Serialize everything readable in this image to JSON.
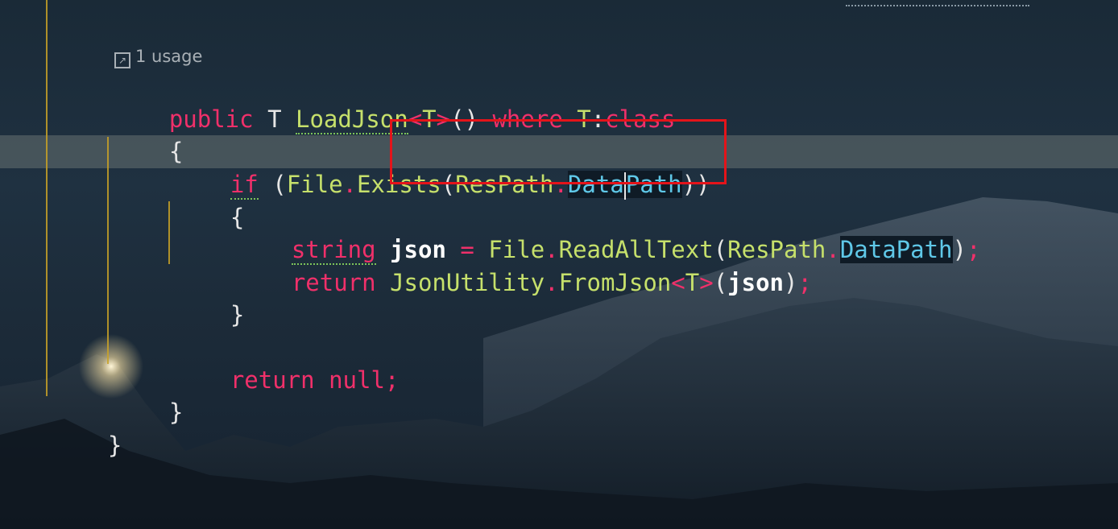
{
  "editor": {
    "usage_hint": "1 usage",
    "usage_icon": "external-link-icon",
    "lines": {
      "l1": {
        "kw_public": "public",
        "type_t": " T ",
        "method": "LoadJson",
        "generic_open": "<",
        "generic_t": "T",
        "generic_close": ">",
        "parens": "()",
        "kw_where": " where ",
        "constraint_t": "T",
        "colon": ":",
        "kw_class": "class"
      },
      "l2": {
        "brace": "{"
      },
      "l3": {
        "kw_if": "if",
        "open_paren": " (",
        "cls_file": "File",
        "dot1": ".",
        "fn_exists": "Exists",
        "paren2": "(",
        "cls_respath": "ResPath",
        "dot2": ".",
        "prop_data": "Data",
        "prop_path": "Path",
        "close": "))"
      },
      "l4": {
        "brace": "{"
      },
      "l5": {
        "kw_string": "string",
        "var_json": " json",
        "eq": " = ",
        "cls_file": "File",
        "dot1": ".",
        "fn_read": "ReadAllText",
        "paren": "(",
        "cls_respath": "ResPath",
        "dot2": ".",
        "prop": "DataPath",
        "close": ")",
        "semi": ";"
      },
      "l6": {
        "kw_return": "return",
        "cls_json": " JsonUtility",
        "dot": ".",
        "fn_from": "FromJson",
        "lt": "<",
        "t": "T",
        "gt": ">",
        "paren": "(",
        "var": "json",
        "close": ")",
        "semi": ";"
      },
      "l7": {
        "brace": "}"
      },
      "l8": {
        "kw_return": "return",
        "kw_null": " null",
        "semi": ";"
      },
      "l9": {
        "brace": "}"
      },
      "l10": {
        "brace": "}"
      }
    },
    "colors": {
      "keyword": "#f0306a",
      "type": "#c6e06b",
      "property": "#5fc8e8",
      "highlight_box": "#e4141a",
      "guide": "#c9a227"
    }
  }
}
